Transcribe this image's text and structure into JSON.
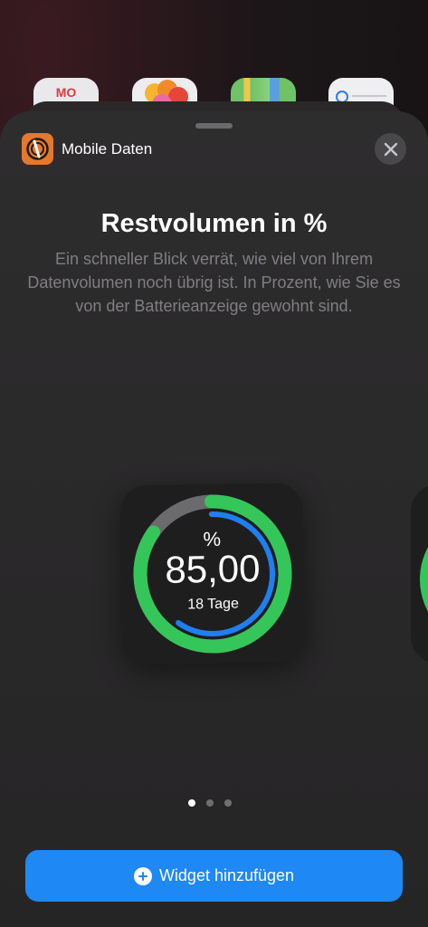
{
  "background_apps": {
    "calendar_label": "MO"
  },
  "sheet": {
    "app_name": "Mobile Daten",
    "app_icon": "mobile-data-app-icon",
    "close_icon": "close-icon",
    "title": "Restvolumen in %",
    "description": "Ein schneller Blick verrät, wie viel von Ihrem Datenvolumen noch übrig ist. In Prozent, wie Sie es von der Batterieanzeige gewohnt sind."
  },
  "widget": {
    "unit": "%",
    "value": "85,00",
    "days": "18 Tage",
    "remaining_percent": 85,
    "inner_ring_percent": 60,
    "colors": {
      "outer_ring": "#34c659",
      "outer_track": "#6b6b6d",
      "inner_ring": "#1e7ff0"
    }
  },
  "pagination": {
    "total": 3,
    "active": 0
  },
  "add_button": {
    "label": "Widget hinzufügen",
    "icon": "plus-circle-icon",
    "color": "#1e88f5"
  }
}
